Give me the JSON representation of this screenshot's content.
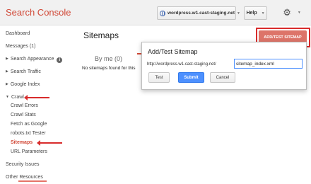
{
  "header": {
    "brand": "Search Console",
    "site_selector": "wordpress.w1.cast-staging.net",
    "help_label": "Help",
    "settings_icon": "gear-icon"
  },
  "sidebar": {
    "items": [
      {
        "label": "Dashboard"
      },
      {
        "label": "Messages (1)"
      },
      {
        "label": "Search Appearance"
      },
      {
        "label": "Search Traffic"
      },
      {
        "label": "Google Index"
      },
      {
        "label": "Crawl"
      },
      {
        "label": "Crawl Errors"
      },
      {
        "label": "Crawl Stats"
      },
      {
        "label": "Fetch as Google"
      },
      {
        "label": "robots.txt Tester"
      },
      {
        "label": "Sitemaps"
      },
      {
        "label": "URL Parameters"
      },
      {
        "label": "Security Issues"
      },
      {
        "label": "Other Resources"
      }
    ]
  },
  "main": {
    "title": "Sitemaps",
    "add_test_button": "ADD/TEST SITEMAP",
    "tabs": [
      {
        "label": "By me (0)"
      }
    ],
    "empty_message": "No sitemaps found for this"
  },
  "dialog": {
    "title": "Add/Test Sitemap",
    "url_prefix": "http://wordpress.w1.cast-staging.net/",
    "input_value": "sitemap_index.xml",
    "test_label": "Test",
    "submit_label": "Submit",
    "cancel_label": "Cancel"
  },
  "colors": {
    "brand": "#d14836",
    "accent_button": "#dd7469",
    "primary_button": "#4d90fe",
    "annotation": "#d82c2c"
  }
}
